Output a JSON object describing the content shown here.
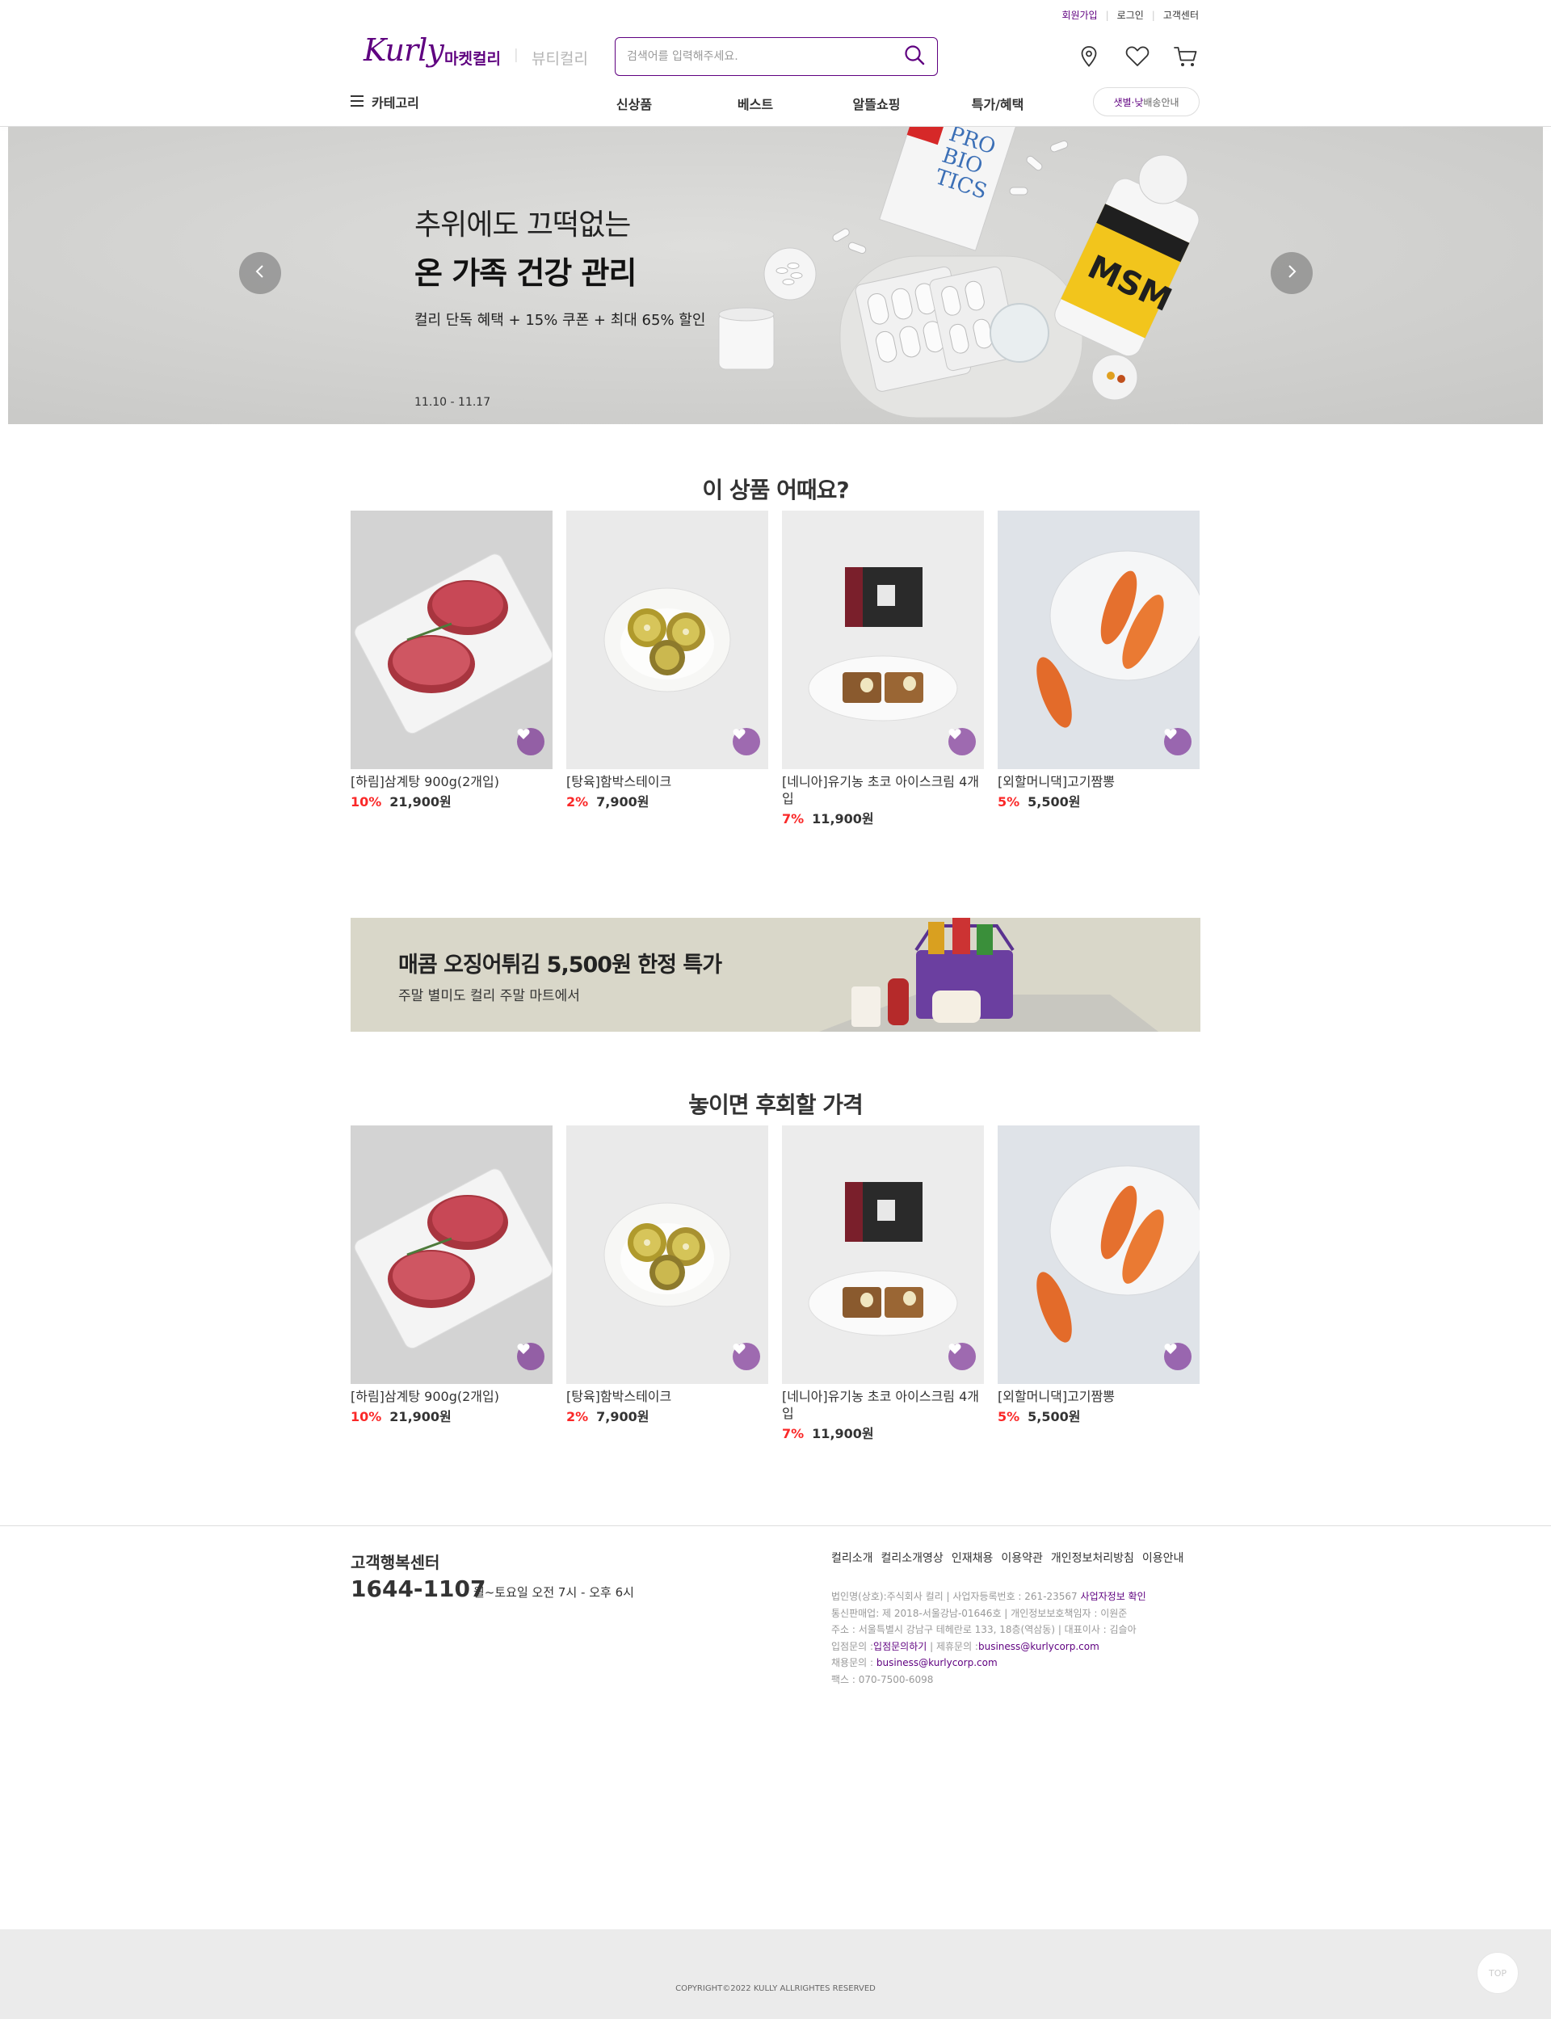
{
  "topbar": {
    "signup": "회원가입",
    "login": "로그인",
    "support": "고객센터"
  },
  "header": {
    "logo": "Kurly",
    "tab_market": "마켓컬리",
    "tab_divider": "|",
    "tab_beauty": "뷰티컬리",
    "search_placeholder": "검색어를 입력해주세요.",
    "icons": [
      "location-icon",
      "heart-icon",
      "cart-icon"
    ]
  },
  "nav": {
    "category": "카테고리",
    "items": [
      "신상품",
      "베스트",
      "알뜰쇼핑",
      "특가/혜택"
    ],
    "delivery_highlight": "샛별·낮",
    "delivery_rest": "배송안내"
  },
  "hero": {
    "line1": "추위에도 끄떡없는",
    "line2": "온 가족 건강 관리",
    "sub": "컬리 단독 혜택 + 15% 쿠폰 + 최대 65% 할인",
    "date": "11.10 - 11.17"
  },
  "section1": {
    "title": "이 상품 어때요?",
    "products": [
      {
        "name": "[하림]삼계탕 900g(2개입)",
        "discount": "10%",
        "price": "21,900원"
      },
      {
        "name": "[탕육]함박스테이크",
        "discount": "2%",
        "price": "7,900원"
      },
      {
        "name": "[네니아]유기농 초코 아이스크림 4개입",
        "discount": "7%",
        "price": "11,900원"
      },
      {
        "name": "[외할머니댁]고기짬뽕",
        "discount": "5%",
        "price": "5,500원"
      }
    ]
  },
  "promo": {
    "title": "매콤 오징어튀김 5,500원 한정 특가",
    "sub": "주말 별미도 컬리 주말 마트에서"
  },
  "section2": {
    "title": "놓이면 후회할 가격",
    "products": [
      {
        "name": "[하림]삼계탕 900g(2개입)",
        "discount": "10%",
        "price": "21,900원"
      },
      {
        "name": "[탕육]함박스테이크",
        "discount": "2%",
        "price": "7,900원"
      },
      {
        "name": "[네니아]유기농 초코 아이스크림 4개입",
        "discount": "7%",
        "price": "11,900원"
      },
      {
        "name": "[외할머니댁]고기짬뽕",
        "discount": "5%",
        "price": "5,500원"
      }
    ]
  },
  "footer": {
    "cs_title": "고객행복센터",
    "cs_phone": "1644-1107",
    "cs_hours": "월~토요일 오전 7시 - 오후 6시",
    "links": [
      "컬리소개",
      "컬리소개영상",
      "인재채용",
      "이용약관",
      "개인정보처리방침",
      "이용안내"
    ],
    "info1": "법인명(상호):주식회사 컬리 | 사업자등록번호 : 261-23567",
    "info1_link": "사업자정보 확인",
    "info2": "통신판매업: 제 2018-서울강남-01646호 | 개인정보보호책임자 : 이원준",
    "info3": "주소 : 서울특별시 강남구 테헤란로 133, 18층(역삼동) | 대표이사 : 김슬아",
    "info4_a": "입점문의 :",
    "info4_link1": "입점문의하기",
    "info4_b": " | 제휴문의 :",
    "info4_link2": "business@kurlycorp.com",
    "info5_a": "채용문의 : ",
    "info5_link": "business@kurlycorp.com",
    "info6": "팩스 : 070-7500-6098",
    "copyright": "COPYRIGHT©2022 KULLY ALLRIGHTES RESERVED",
    "top_button": "TOP"
  },
  "colors": {
    "brand": "#5f0080",
    "discount": "#fa2828"
  }
}
